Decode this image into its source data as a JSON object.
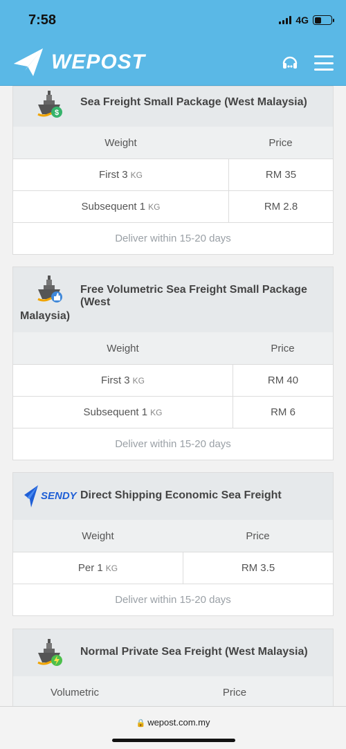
{
  "status": {
    "time": "7:58",
    "network": "4G"
  },
  "nav": {
    "brand": "WEPOST",
    "icons": [
      "support-headset-icon",
      "hamburger-menu-icon"
    ]
  },
  "cards": [
    {
      "title": "Sea Freight Small Package (West Malaysia)",
      "icon": "ship-dollar-icon",
      "col1": "Weight",
      "col2": "Price",
      "rows": [
        {
          "label": "First 3",
          "unit": "KG",
          "price": "RM 35"
        },
        {
          "label": "Subsequent 1",
          "unit": "KG",
          "price": "RM 2.8"
        }
      ],
      "note": "Deliver within 15-20 days"
    },
    {
      "title_line1": "Free Volumetric Sea Freight Small Package (West",
      "title_line2": "Malaysia)",
      "icon": "ship-thumbs-up-icon",
      "col1": "Weight",
      "col2": "Price",
      "rows": [
        {
          "label": "First 3",
          "unit": "KG",
          "price": "RM 40"
        },
        {
          "label": "Subsequent 1",
          "unit": "KG",
          "price": "RM 6"
        }
      ],
      "note": "Deliver within 15-20 days"
    },
    {
      "title": "Direct Shipping Economic Sea Freight",
      "logo_text": "SENDY",
      "col1": "Weight",
      "col2": "Price",
      "rows": [
        {
          "label": "Per 1",
          "unit": "KG",
          "price": "RM 3.5"
        }
      ],
      "note": "Deliver within 15-20 days"
    },
    {
      "title": "Normal Private Sea Freight (West Malaysia)",
      "icon": "ship-lightning-icon",
      "col1": "Volumetric",
      "col2": "Price"
    }
  ],
  "browser": {
    "url": "wepost.com.my"
  },
  "colors": {
    "brand_blue": "#5ab8e6",
    "header_grey": "#e6e9eb",
    "text": "#555555",
    "muted": "#9aa0a6"
  }
}
